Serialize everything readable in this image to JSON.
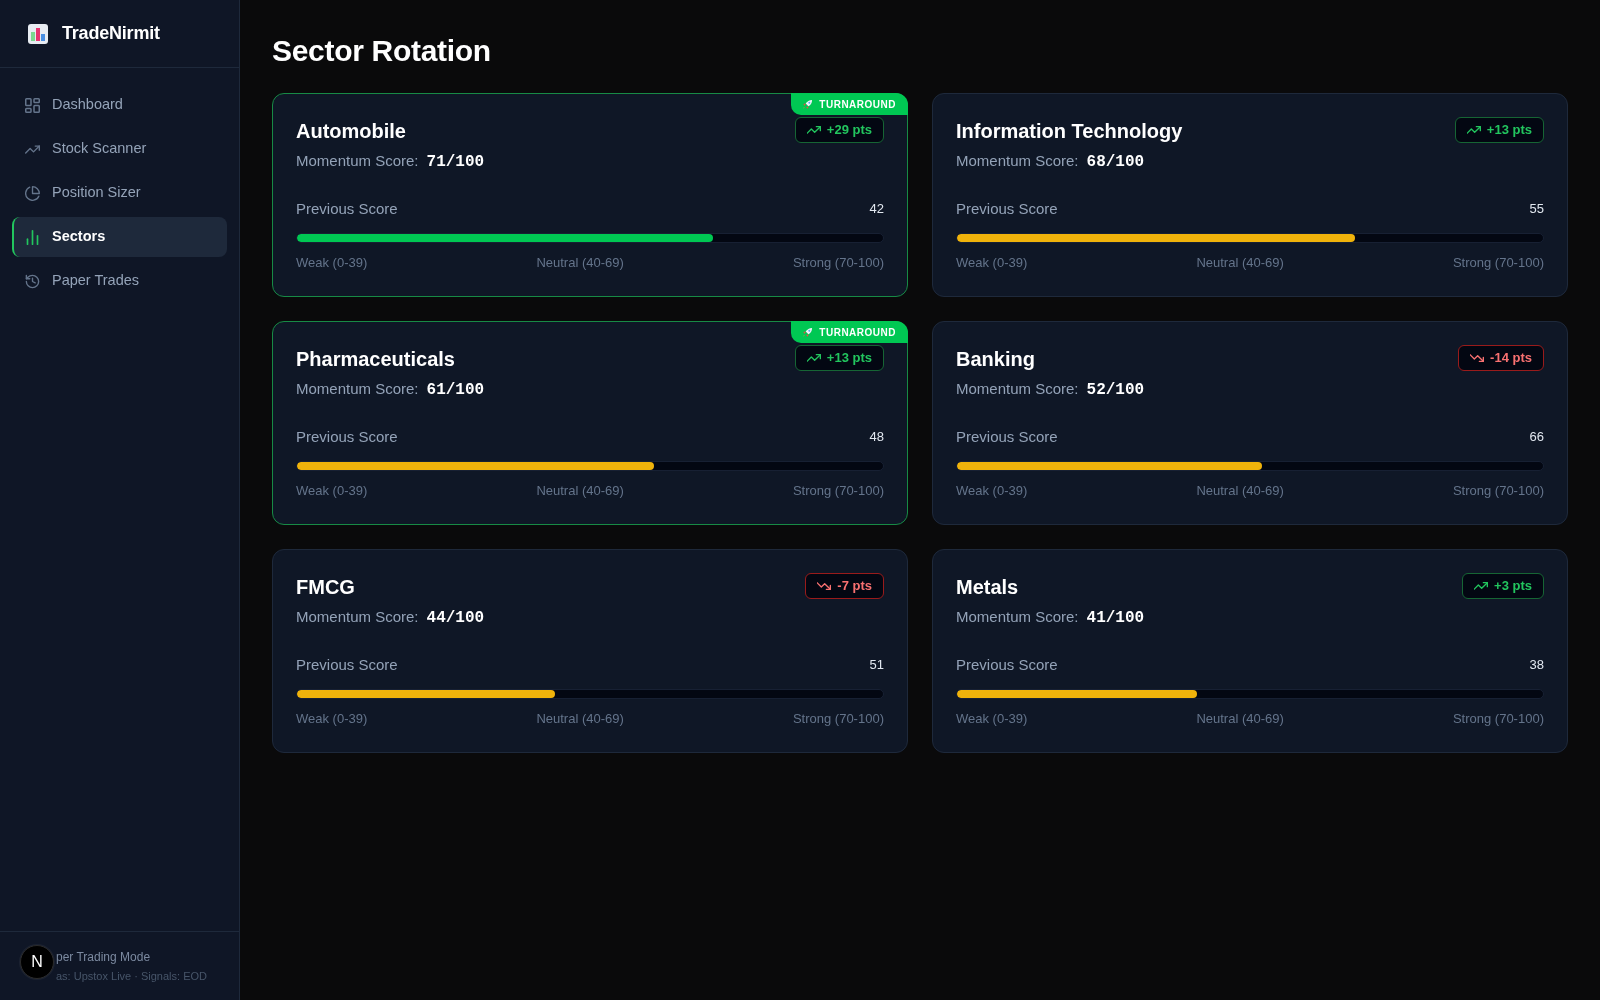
{
  "sidebar": {
    "brand": "TradeNirmit",
    "items": [
      {
        "label": "Dashboard",
        "selected": false
      },
      {
        "label": "Stock Scanner",
        "selected": false
      },
      {
        "label": "Position Sizer",
        "selected": false
      },
      {
        "label": "Sectors",
        "selected": true
      },
      {
        "label": "Paper Trades",
        "selected": false
      }
    ],
    "footer": {
      "mode": "per Trading Mode",
      "sources": "as: Upstox Live · Signals: EOD"
    }
  },
  "page": {
    "title": "Sector Rotation"
  },
  "sectors": [
    {
      "name": "Automobile",
      "tag": "TURNAROUND",
      "change": {
        "kind": "up",
        "text": "+29 pts"
      },
      "momentum_label": "Momentum Score:",
      "momentum": "71/100",
      "previous_label": "Previous Score",
      "previous": "42",
      "level": 0.71,
      "color": "#00c853",
      "scale": [
        "Weak (0-39)",
        "Neutral (40-69)",
        "Strong (70-100)"
      ]
    },
    {
      "name": "Information Technology",
      "change": {
        "kind": "up",
        "text": "+13 pts"
      },
      "momentum_label": "Momentum Score:",
      "momentum": "68/100",
      "previous_label": "Previous Score",
      "previous": "55",
      "level": 0.68,
      "color": "#f0b30b",
      "scale": [
        "Weak (0-39)",
        "Neutral (40-69)",
        "Strong (70-100)"
      ]
    },
    {
      "name": "Pharmaceuticals",
      "tag": "TURNAROUND",
      "change": {
        "kind": "up",
        "text": "+13 pts"
      },
      "momentum_label": "Momentum Score:",
      "momentum": "61/100",
      "previous_label": "Previous Score",
      "previous": "48",
      "level": 0.61,
      "color": "#f0b30b",
      "scale": [
        "Weak (0-39)",
        "Neutral (40-69)",
        "Strong (70-100)"
      ]
    },
    {
      "name": "Banking",
      "change": {
        "kind": "down",
        "text": "-14 pts"
      },
      "momentum_label": "Momentum Score:",
      "momentum": "52/100",
      "previous_label": "Previous Score",
      "previous": "66",
      "level": 0.52,
      "color": "#f0b30b",
      "scale": [
        "Weak (0-39)",
        "Neutral (40-69)",
        "Strong (70-100)"
      ]
    },
    {
      "name": "FMCG",
      "change": {
        "kind": "down",
        "text": "-7 pts"
      },
      "momentum_label": "Momentum Score:",
      "momentum": "44/100",
      "previous_label": "Previous Score",
      "previous": "51",
      "level": 0.44,
      "color": "#f0b30b",
      "scale": [
        "Weak (0-39)",
        "Neutral (40-69)",
        "Strong (70-100)"
      ]
    },
    {
      "name": "Metals",
      "change": {
        "kind": "up",
        "text": "+3 pts"
      },
      "momentum_label": "Momentum Score:",
      "momentum": "41/100",
      "previous_label": "Previous Score",
      "previous": "38",
      "level": 0.41,
      "color": "#f0b30b",
      "scale": [
        "Weak (0-39)",
        "Neutral (40-69)",
        "Strong (70-100)"
      ]
    }
  ],
  "dev_badge": {
    "label": "N"
  }
}
